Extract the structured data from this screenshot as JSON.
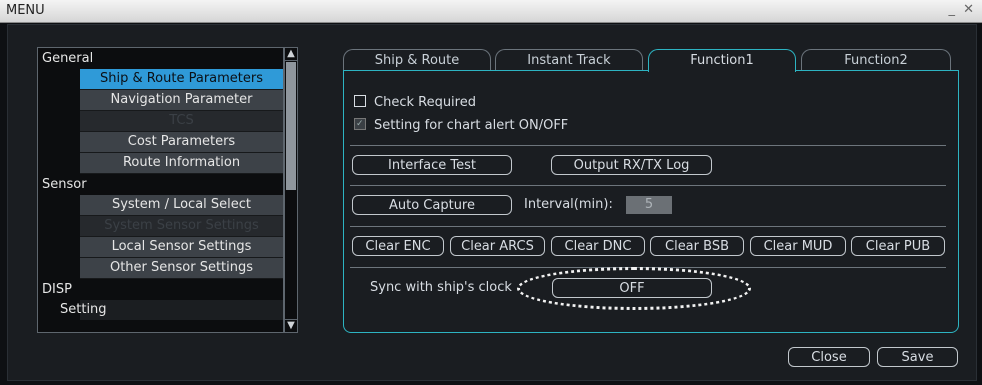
{
  "window": {
    "title": "MENU",
    "controls": "_ ✕"
  },
  "tree": {
    "categories": [
      {
        "label": "General"
      },
      {
        "label": "Sensor"
      },
      {
        "label": "DISP"
      }
    ],
    "items": [
      {
        "label": "Ship & Route Parameters"
      },
      {
        "label": "Navigation Parameter"
      },
      {
        "label": "TCS"
      },
      {
        "label": "Cost Parameters"
      },
      {
        "label": "Route Information"
      },
      {
        "label": "System / Local Select"
      },
      {
        "label": "System Sensor Settings"
      },
      {
        "label": "Local Sensor Settings"
      },
      {
        "label": "Other Sensor Settings"
      },
      {
        "label": "Setting"
      }
    ],
    "selected": "Ship & Route Parameters",
    "scroll_up_icon": "▲",
    "scroll_down_icon": "▼"
  },
  "tabs": [
    {
      "label": "Ship & Route"
    },
    {
      "label": "Instant Track"
    },
    {
      "label": "Function1"
    },
    {
      "label": "Function2"
    }
  ],
  "active_tab": "Function1",
  "function1": {
    "check_required": {
      "label": "Check Required",
      "checked": false
    },
    "chart_alert": {
      "label": "Setting for chart alert ON/OFF",
      "checked": true
    },
    "interface_test": "Interface Test",
    "output_log": "Output RX/TX Log",
    "auto_capture": "Auto Capture",
    "interval_label": "Interval(min):",
    "interval_value": "5",
    "clear_buttons": [
      "Clear ENC",
      "Clear ARCS",
      "Clear DNC",
      "Clear BSB",
      "Clear MUD",
      "Clear PUB"
    ],
    "sync_label": "Sync with ship's clock",
    "sync_value": "OFF"
  },
  "footer": {
    "close": "Close",
    "save": "Save"
  }
}
